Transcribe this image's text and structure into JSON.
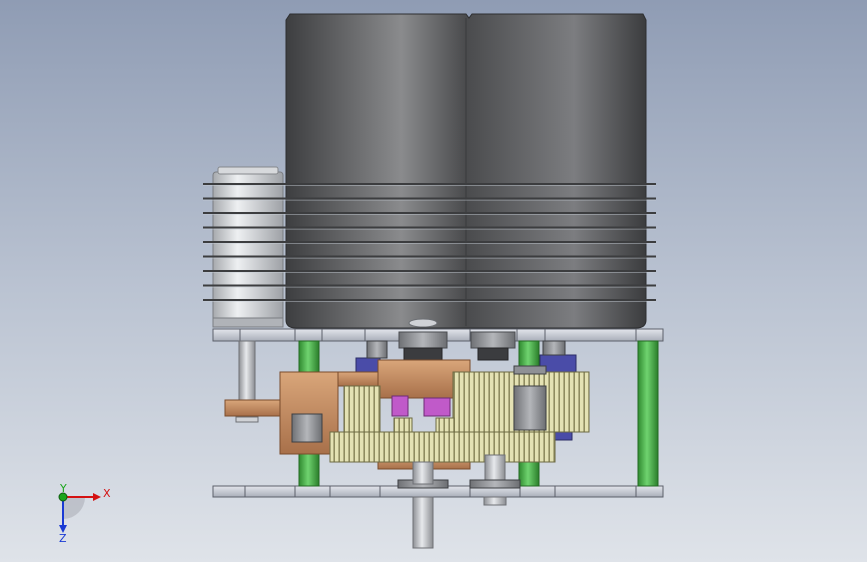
{
  "axes": {
    "x_label": "X",
    "y_label": "Y",
    "z_label": "Z",
    "x_color": "#d41111",
    "y_color": "#1aa51a",
    "z_color": "#1a3ad4"
  },
  "colors": {
    "background_top": "#8f9cb4",
    "background_bottom": "#dfe3e9",
    "housing": "#4a4b4d",
    "housing_highlight": "#8a8b8d",
    "fin": "#3c3d3f",
    "canister": "#c9cbce",
    "plate": "#c6cad3",
    "spacer": "#3daa3d",
    "bronze": "#c28a5c",
    "gear_yellow": "#e4e2b4",
    "magenta": "#c05ac9",
    "blue_washer": "#4a4ca8",
    "shaft": "#b9bbbf"
  }
}
